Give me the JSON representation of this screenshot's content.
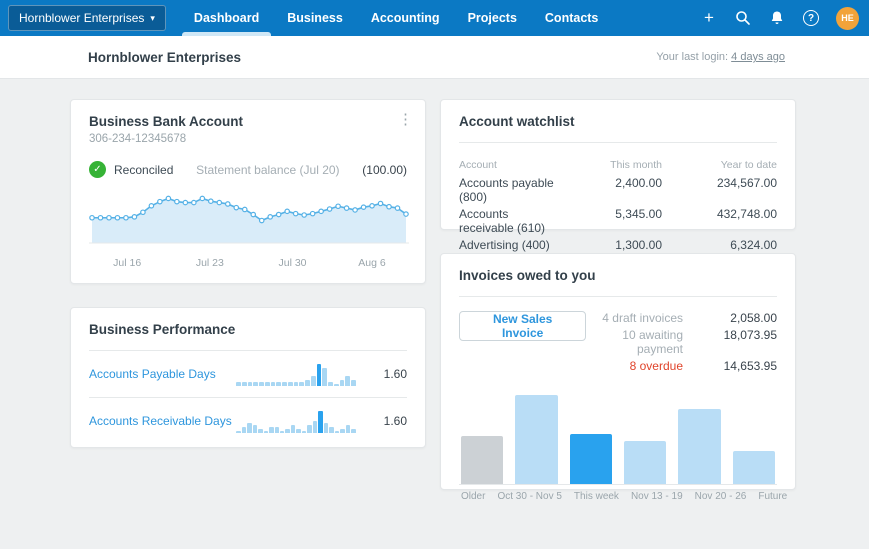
{
  "nav": {
    "org_selector": "Hornblower Enterprises",
    "items": [
      {
        "label": "Dashboard",
        "active": true
      },
      {
        "label": "Business",
        "active": false
      },
      {
        "label": "Accounting",
        "active": false
      },
      {
        "label": "Projects",
        "active": false
      },
      {
        "label": "Contacts",
        "active": false
      }
    ],
    "avatar_initials": "HE"
  },
  "icons": {
    "plus": "+",
    "question": "?",
    "caret": "▾",
    "kebab": "⋮",
    "check": "✓"
  },
  "header": {
    "title": "Hornblower Enterprises",
    "last_login_label": "Your last login:",
    "last_login_link": "4 days ago"
  },
  "bank_card": {
    "title": "Business Bank Account",
    "account_number": "306-234-12345678",
    "status": "Reconciled",
    "statement_label": "Statement balance (Jul 20)",
    "statement_value": "(100.00)"
  },
  "performance_card": {
    "title": "Business Performance",
    "rows": [
      {
        "label": "Accounts Payable Days",
        "value": "1.60"
      },
      {
        "label": "Accounts Receivable Days",
        "value": "1.60"
      }
    ]
  },
  "watchlist_card": {
    "title": "Account watchlist",
    "columns": [
      "Account",
      "This month",
      "Year to date"
    ],
    "rows": [
      {
        "account": "Accounts payable (800)",
        "this_month": "2,400.00",
        "year_to_date": "234,567.00"
      },
      {
        "account": "Accounts receivable (610)",
        "this_month": "5,345.00",
        "year_to_date": "432,748.00"
      },
      {
        "account": "Advertising (400)",
        "this_month": "1,300.00",
        "year_to_date": "6,324.00"
      }
    ]
  },
  "invoices_card": {
    "title": "Invoices owed to you",
    "button_label": "New Sales Invoice",
    "summary": [
      {
        "label": "4 draft invoices",
        "value": "2,058.00",
        "overdue": false
      },
      {
        "label": "10 awaiting payment",
        "value": "18,073.95",
        "overdue": false
      },
      {
        "label": "8 overdue",
        "value": "14,653.95",
        "overdue": true
      }
    ]
  },
  "chart_data": [
    {
      "type": "area",
      "title": "Business Bank Account balance sparkline",
      "x_labels": [
        "Jul 16",
        "Jul 23",
        "Jul 30",
        "Aug 6"
      ],
      "x_label_pos_pct": [
        12,
        38,
        64,
        89
      ],
      "values": [
        44,
        44,
        44,
        44,
        44,
        46,
        56,
        70,
        79,
        86,
        79,
        77,
        77,
        86,
        80,
        77,
        74,
        66,
        62,
        51,
        38,
        46,
        51,
        58,
        53,
        50,
        53,
        58,
        63,
        69,
        65,
        61,
        67,
        70,
        75,
        68,
        65,
        52
      ],
      "ylim": [
        0,
        100
      ],
      "line_color": "#55b1e6",
      "fill_color": "#d9ecf9",
      "marker_fill": "#ffffff"
    },
    {
      "type": "bar",
      "title": "Accounts Payable Days mini chart",
      "values": [
        2,
        2,
        2,
        2,
        2,
        2,
        2,
        2,
        2,
        2,
        2,
        2,
        3,
        5,
        11,
        9,
        2,
        1,
        3,
        5,
        3
      ],
      "highlight_index": 14,
      "bar_color": "#a9d7f3",
      "highlight_color": "#2aa2ee",
      "ylim": [
        0,
        12
      ]
    },
    {
      "type": "bar",
      "title": "Accounts Receivable Days mini chart",
      "values": [
        1,
        3,
        5,
        4,
        2,
        1,
        3,
        3,
        1,
        2,
        4,
        2,
        1,
        4,
        6,
        11,
        5,
        3,
        1,
        2,
        4,
        2
      ],
      "highlight_index": 15,
      "bar_color": "#a9d7f3",
      "highlight_color": "#2aa2ee",
      "ylim": [
        0,
        12
      ]
    },
    {
      "type": "bar",
      "title": "Invoices owed to you by week",
      "categories": [
        "Older",
        "Oct 30 - Nov 5",
        "This week",
        "Nov 13 - 19",
        "Nov 20 - 26",
        "Future"
      ],
      "values": [
        48,
        90,
        51,
        43,
        76,
        33
      ],
      "ylim": [
        0,
        100
      ],
      "bar_colors": [
        "#ccd1d5",
        "#b9ddf6",
        "#29a2ee",
        "#b9ddf6",
        "#b9ddf6",
        "#b9ddf6"
      ]
    }
  ],
  "colors": {
    "nav_blue": "#0b79c4",
    "link_blue": "#2e96dd",
    "reconciled_green": "#36b336",
    "overdue_red": "#e0442b",
    "avatar_orange": "#f2a33a",
    "page_bg": "#eef0f1"
  }
}
